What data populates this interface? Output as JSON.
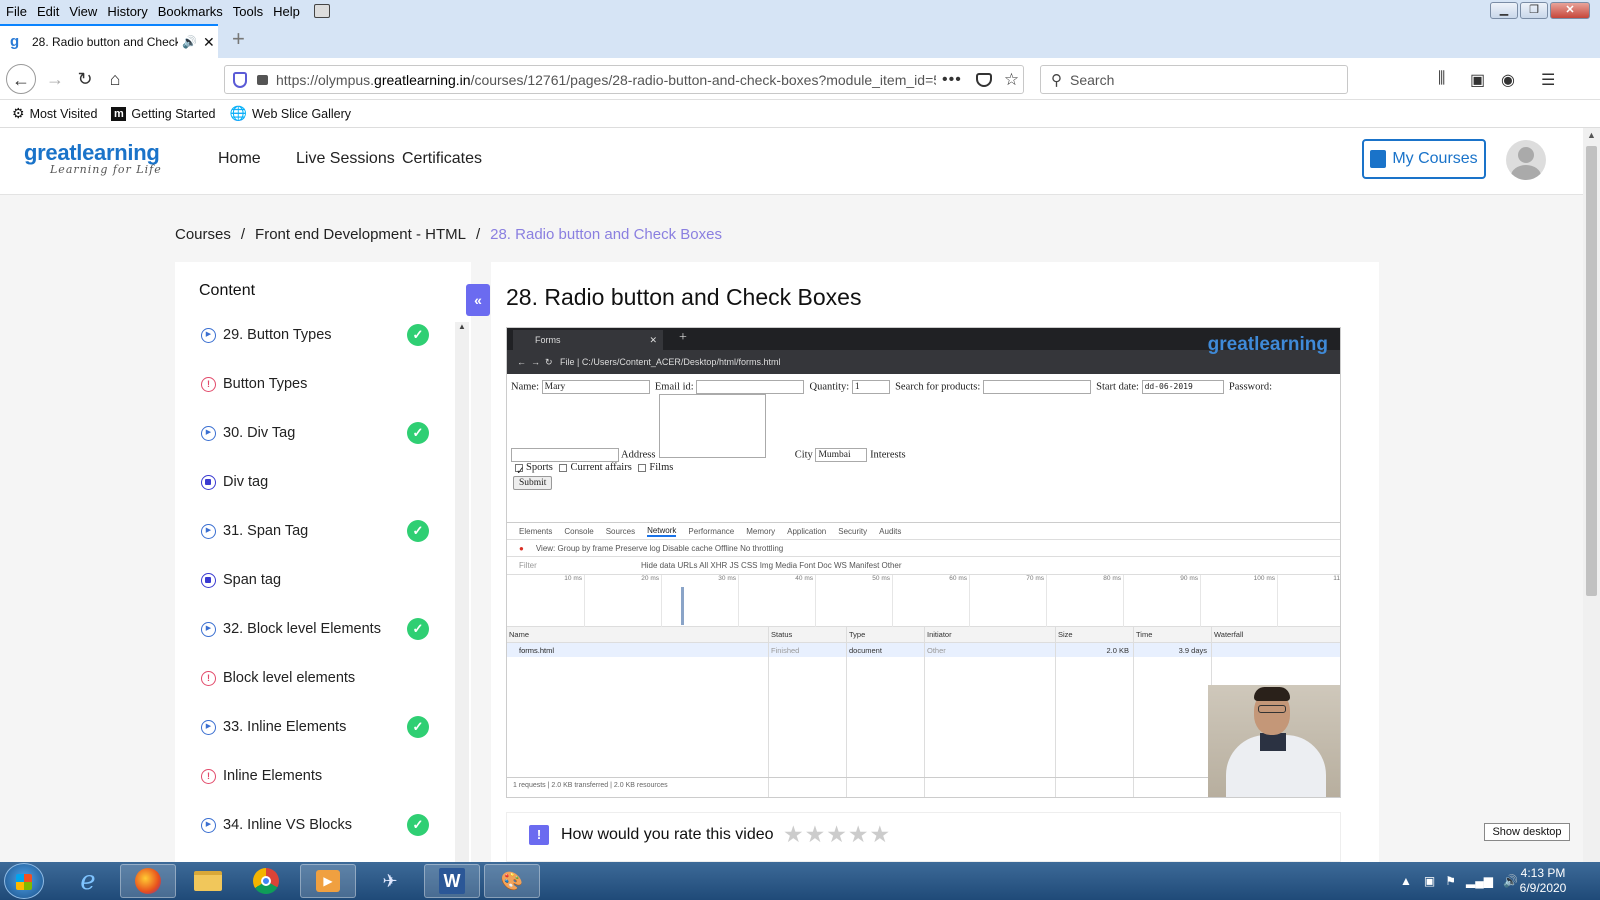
{
  "menubar": {
    "items": [
      "File",
      "Edit",
      "View",
      "History",
      "Bookmarks",
      "Tools",
      "Help"
    ]
  },
  "browser": {
    "tab_title": "28. Radio button and Check",
    "url_prefix": "https://olympus.",
    "url_domain": "greatlearning.in",
    "url_rest": "/courses/12761/pages/28-radio-button-and-check-boxes?module_item_id=5",
    "search_placeholder": "Search",
    "bookmarks": [
      "Most Visited",
      "Getting Started",
      "Web Slice Gallery"
    ]
  },
  "site": {
    "logo_main": "greatlearning",
    "logo_tag": "Learning for Life",
    "nav": [
      "Home",
      "Live Sessions",
      "Certificates"
    ],
    "my_courses": "My Courses",
    "breadcrumb": [
      "Courses",
      "Front end Development - HTML",
      "28. Radio button and Check Boxes"
    ],
    "sidebar_title": "Content",
    "collapse_glyph": "«",
    "page_title": "28. Radio button and Check Boxes",
    "items": [
      {
        "label": "29. Button Types",
        "kind": "video",
        "done": true
      },
      {
        "label": "Button Types",
        "kind": "resource",
        "done": false
      },
      {
        "label": "30. Div Tag",
        "kind": "video",
        "done": true
      },
      {
        "label": "Div tag",
        "kind": "doc",
        "done": false
      },
      {
        "label": "31. Span Tag",
        "kind": "video",
        "done": true
      },
      {
        "label": "Span tag",
        "kind": "doc",
        "done": false
      },
      {
        "label": "32. Block level Elements",
        "kind": "video",
        "done": true
      },
      {
        "label": "Block level elements",
        "kind": "resource",
        "done": false
      },
      {
        "label": "33. Inline Elements",
        "kind": "video",
        "done": true
      },
      {
        "label": "Inline Elements",
        "kind": "resource",
        "done": false
      },
      {
        "label": "34. Inline VS Blocks",
        "kind": "video",
        "done": true
      }
    ],
    "rating_question": "How would you rate this video",
    "rating_stars": "★★★★★"
  },
  "video": {
    "tab_title": "Forms",
    "url": "File  |  C:/Users/Content_ACER/Desktop/html/forms.html",
    "logo": "greatlearning",
    "form": {
      "name_label": "Name:",
      "name_value": "Mary",
      "email_label": "Email id:",
      "qty_label": "Quantity:",
      "qty_value": "1",
      "search_label": "Search for products:",
      "start_label": "Start date:",
      "start_value": "dd-06-2019",
      "password_label": "Password:",
      "address_label": "Address",
      "city_label": "City",
      "city_value": "Mumbai",
      "interests_label": "Interests",
      "cb1": "Sports",
      "cb2": "Current affairs",
      "cb3": "Films",
      "submit": "Submit"
    },
    "devtools": {
      "tabs": [
        "Elements",
        "Console",
        "Sources",
        "Network",
        "Performance",
        "Memory",
        "Application",
        "Security",
        "Audits"
      ],
      "toolbar": "View:     Group by frame     Preserve log     Disable cache     Offline   No throttling",
      "filter": "Filter",
      "filter_types": "Hide data URLs   All   XHR   JS   CSS   Img   Media   Font   Doc   WS   Manifest   Other",
      "ticks": [
        "10 ms",
        "20 ms",
        "30 ms",
        "40 ms",
        "50 ms",
        "60 ms",
        "70 ms",
        "80 ms",
        "90 ms",
        "100 ms",
        "11"
      ],
      "columns": [
        "Name",
        "Status",
        "Type",
        "Initiator",
        "Size",
        "Time",
        "Waterfall"
      ],
      "row": [
        "forms.html",
        "Finished",
        "document",
        "Other",
        "2.0 KB",
        "3.9 days"
      ],
      "footer": "1 requests  |  2.0 KB transferred  |  2.0 KB resources"
    }
  },
  "taskbar": {
    "time": "4:13 PM",
    "date": "6/9/2020",
    "show_desktop": "Show desktop"
  }
}
